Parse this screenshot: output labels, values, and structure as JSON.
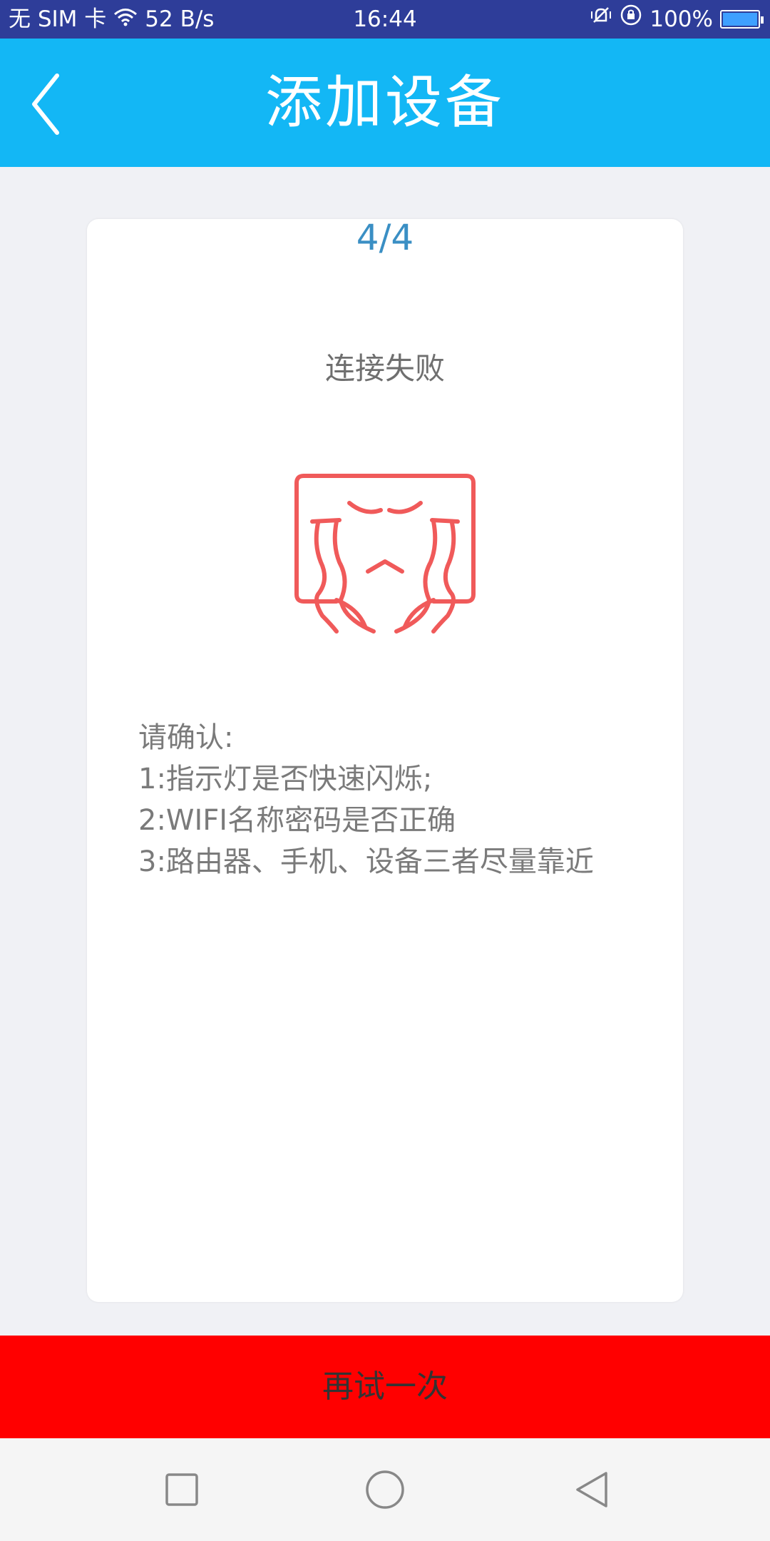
{
  "status_bar": {
    "carrier": "无 SIM 卡",
    "speed": "52 B/s",
    "time": "16:44",
    "battery": "100%",
    "icons": [
      "wifi-icon",
      "vibrate-icon",
      "rotation-lock-icon",
      "battery-icon"
    ]
  },
  "header": {
    "title": "添加设备",
    "back_icon": "chevron-left-icon"
  },
  "card": {
    "step": "4/4",
    "status": "连接失败",
    "illustration": "crying-face-icon",
    "tips": [
      "请确认:",
      "1:指示灯是否快速闪烁;",
      "2:WIFI名称密码是否正确",
      "3:路由器、手机、设备三者尽量靠近"
    ]
  },
  "retry_button": {
    "label": "再试一次"
  },
  "nav": {
    "items": [
      "recents-square-icon",
      "home-circle-icon",
      "back-triangle-icon"
    ]
  },
  "colors": {
    "status_bar": "#2e3d99",
    "app_bar": "#13b7f5",
    "background": "#f0f1f5",
    "step_text": "#3a8fc4",
    "illustration": "#f05a5a",
    "retry_button": "#ff0000"
  }
}
